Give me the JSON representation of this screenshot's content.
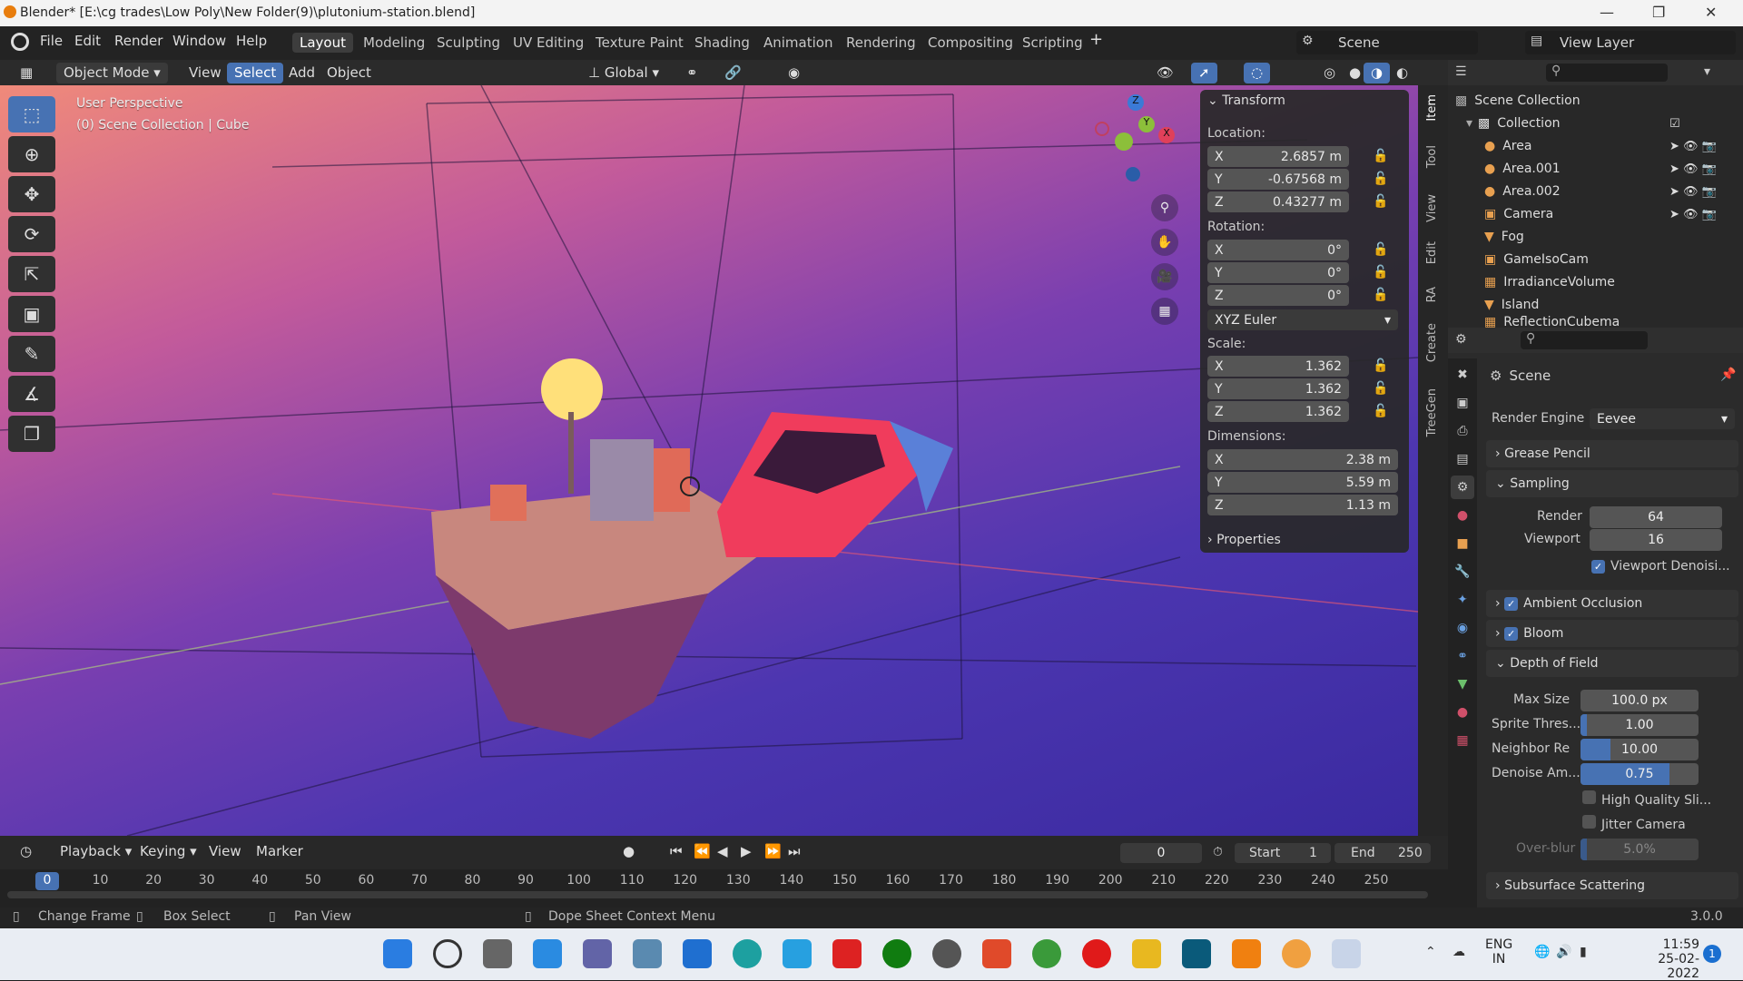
{
  "window": {
    "title": "Blender* [E:\\cg trades\\Low Poly\\New Folder(9)\\plutonium-station.blend]"
  },
  "menu": {
    "items": [
      "File",
      "Edit",
      "Render",
      "Window",
      "Help"
    ]
  },
  "workspaces": [
    "Layout",
    "Modeling",
    "Sculpting",
    "UV Editing",
    "Texture Paint",
    "Shading",
    "Animation",
    "Rendering",
    "Compositing",
    "Scripting"
  ],
  "scene": {
    "name": "Scene",
    "view_layer": "View Layer"
  },
  "header3d": {
    "mode": "Object Mode",
    "view": "View",
    "select": "Select",
    "add": "Add",
    "object": "Object",
    "orientation": "Global"
  },
  "viewport": {
    "perspective": "User Perspective",
    "collection": "(0) Scene Collection | Cube"
  },
  "transform": {
    "title": "Transform",
    "location_label": "Location:",
    "location": [
      {
        "axis": "X",
        "value": "2.6857 m"
      },
      {
        "axis": "Y",
        "value": "-0.67568 m"
      },
      {
        "axis": "Z",
        "value": "0.43277 m"
      }
    ],
    "rotation_label": "Rotation:",
    "rotation": [
      {
        "axis": "X",
        "value": "0°"
      },
      {
        "axis": "Y",
        "value": "0°"
      },
      {
        "axis": "Z",
        "value": "0°"
      }
    ],
    "rotation_mode": "XYZ Euler",
    "scale_label": "Scale:",
    "scale": [
      {
        "axis": "X",
        "value": "1.362"
      },
      {
        "axis": "Y",
        "value": "1.362"
      },
      {
        "axis": "Z",
        "value": "1.362"
      }
    ],
    "dimensions_label": "Dimensions:",
    "dimensions": [
      {
        "axis": "X",
        "value": "2.38 m"
      },
      {
        "axis": "Y",
        "value": "5.59 m"
      },
      {
        "axis": "Z",
        "value": "1.13 m"
      }
    ],
    "properties": "Properties"
  },
  "side_tabs": [
    "Item",
    "Tool",
    "View",
    "Edit",
    "RA",
    "Create",
    "TreeGen"
  ],
  "outliner": {
    "root": "Scene Collection",
    "collection": "Collection",
    "items": [
      "Area",
      "Area.001",
      "Area.002",
      "Camera",
      "Fog",
      "GameIsoCam",
      "IrradianceVolume",
      "Island",
      "ReflectionCubema"
    ]
  },
  "properties": {
    "context": "Scene",
    "render_engine_label": "Render Engine",
    "render_engine": "Eevee",
    "grease_pencil": "Grease Pencil",
    "sampling": "Sampling",
    "render_label": "Render",
    "render_samples": "64",
    "viewport_label": "Viewport",
    "viewport_samples": "16",
    "viewport_denoise": "Viewport Denoisi...",
    "ambient_occlusion": "Ambient Occlusion",
    "bloom": "Bloom",
    "depth_of_field": "Depth of Field",
    "max_size_label": "Max Size",
    "max_size": "100.0 px",
    "sprite_label": "Sprite Thres...",
    "sprite": "1.00",
    "sprite_fill": 0.05,
    "neighbor_label": "Neighbor Re",
    "neighbor": "10.00",
    "neighbor_fill": 0.25,
    "denoise_label": "Denoise Am...",
    "denoise": "0.75",
    "denoise_fill": 0.75,
    "high_quality": "High Quality Sli...",
    "jitter": "Jitter Camera",
    "overblur_label": "Over-blur",
    "overblur": "5.0%",
    "overblur_fill": 0.05,
    "subsurface": "Subsurface Scattering"
  },
  "timeline": {
    "playback": "Playback",
    "keying": "Keying",
    "view": "View",
    "marker": "Marker",
    "current_frame": "0",
    "start_label": "Start",
    "start": "1",
    "end_label": "End",
    "end": "250",
    "ticks": [
      "0",
      "10",
      "20",
      "30",
      "40",
      "50",
      "60",
      "70",
      "80",
      "90",
      "100",
      "110",
      "120",
      "130",
      "140",
      "150",
      "160",
      "170",
      "180",
      "190",
      "200",
      "210",
      "220",
      "230",
      "240",
      "250"
    ]
  },
  "status": {
    "change_frame": "Change Frame",
    "box_select": "Box Select",
    "pan_view": "Pan View",
    "context_menu": "Dope Sheet Context Menu",
    "version": "3.0.0"
  },
  "tray": {
    "lang": "ENG",
    "region": "IN",
    "time": "11:59",
    "date": "25-02-2022",
    "badge": "1"
  }
}
